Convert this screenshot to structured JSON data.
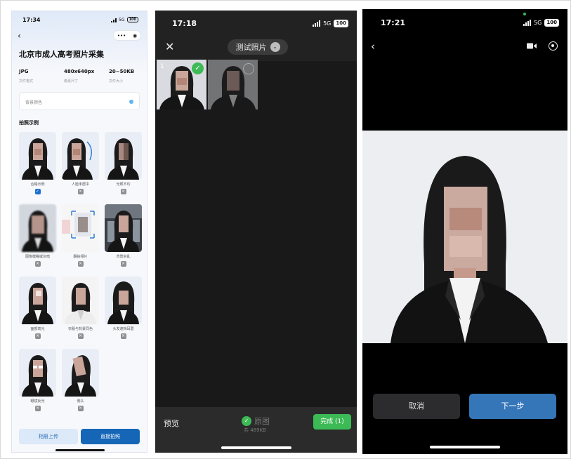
{
  "screen1": {
    "status_time": "17:34",
    "network": "5G",
    "battery": "100",
    "title": "北京市成人高考照片采集",
    "specs": [
      {
        "value": "JPG",
        "label": "文件格式"
      },
      {
        "value": "480x640px",
        "label": "像素尺寸"
      },
      {
        "value": "20~50KB",
        "label": "文件大小"
      }
    ],
    "bg_color_label": "背景颜色",
    "bg_color_swatch": "#63b5f0",
    "examples_title": "拍照示例",
    "examples": [
      {
        "label": "合格示例",
        "ok": true
      },
      {
        "label": "人脸未居中",
        "ok": false
      },
      {
        "label": "光照不均",
        "ok": false
      },
      {
        "label": "图像模糊或灰暗",
        "ok": false
      },
      {
        "label": "翻拍相片",
        "ok": false
      },
      {
        "label": "背景杂乱",
        "ok": false
      },
      {
        "label": "面部高光",
        "ok": false
      },
      {
        "label": "衣服与背景同色",
        "ok": false
      },
      {
        "label": "头发遮挡耳眉",
        "ok": false
      },
      {
        "label": "眼镜反光",
        "ok": false
      },
      {
        "label": "侧头",
        "ok": false
      }
    ],
    "check_mark": "✓",
    "cross_mark": "×",
    "album_upload": "相册上传",
    "direct_shoot": "直接拍照",
    "back_icon": "‹",
    "more_icon": "•••",
    "target_icon": "◉"
  },
  "screen2": {
    "status_time": "17:18",
    "network": "5G",
    "battery": "100",
    "close_icon": "✕",
    "album_name": "测试照片",
    "dropdown_icon": "⌄",
    "photo_index": "1",
    "check_icon": "✓",
    "preview": "预览",
    "original": "原图",
    "total_size": "共 489KB",
    "done_button": "完成 (1)"
  },
  "screen3": {
    "status_time": "17:21",
    "network": "5G",
    "battery": "100",
    "back_icon": "‹",
    "cancel": "取消",
    "next_step": "下一步"
  }
}
